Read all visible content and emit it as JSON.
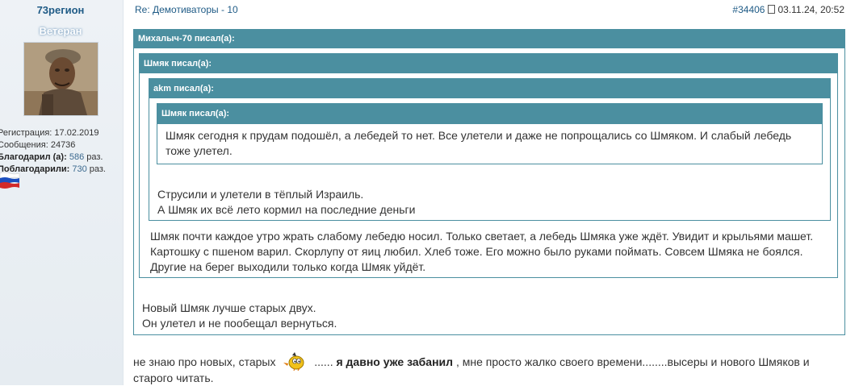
{
  "user": {
    "name": "73регион",
    "rank": "Ветеран",
    "registration_label": "Регистрация:",
    "registration_date": "17.02.2019",
    "messages_label": "Сообщения:",
    "messages_count": "24736",
    "thanked_label": "Благодарил (а):",
    "thanked_count": "586",
    "thanked_suffix": "раз.",
    "thanked_by_label": "Поблагодарили:",
    "thanked_by_count": "730",
    "thanked_by_suffix": "раз.",
    "flag_colors": [
      "#ffffff",
      "#1c4fbf",
      "#d22a2a"
    ]
  },
  "post": {
    "title": "Re: Демотиваторы - 10",
    "number": "#34406",
    "datetime": "03.11.24, 20:52"
  },
  "quotes": {
    "q1_author": "Михалыч-70 писал(а):",
    "q2_author": "Шмяк писал(а):",
    "q3_author": "akm писал(а):",
    "q4_author": "Шмяк писал(а):",
    "q4_text": "Шмяк сегодня к прудам подошёл, а лебедей то нет. Все улетели и даже не попрощались со Шмяком. И слабый лебедь тоже улетел.",
    "q3_text_line1": "Струсили и улетели в тёплый Израиль.",
    "q3_text_line2": "А Шмяк их всё лето кормил на последние деньги",
    "q2_text": "Шмяк почти каждое утро жрать слабому лебедю носил. Только светает, а лебедь Шмяка уже ждёт. Увидит и крыльями машет. Картошку с пшеном варил. Скорлупу от яиц любил. Хлеб тоже. Его можно было руками поймать. Совсем Шмяка не боялся. Другие на берег выходили только когда Шмяк уйдёт.",
    "q1_text_line1": "Новый Шмяк лучше старых двух.",
    "q1_text_line2": "Он улетел и не пообещал вернуться."
  },
  "body": {
    "part1": "не знаю про новых, старых",
    "part2": "......",
    "bold": "я давно уже забанил",
    "part3": ", мне просто жалко своего времени........высеры и нового Шмяков и старого читать."
  },
  "colors": {
    "quote_header": "#4b8fa0",
    "link": "#1f5b86"
  },
  "icons": [
    "avatar-photo",
    "document-icon",
    "russia-flag-icon",
    "bird-smiley-icon"
  ]
}
